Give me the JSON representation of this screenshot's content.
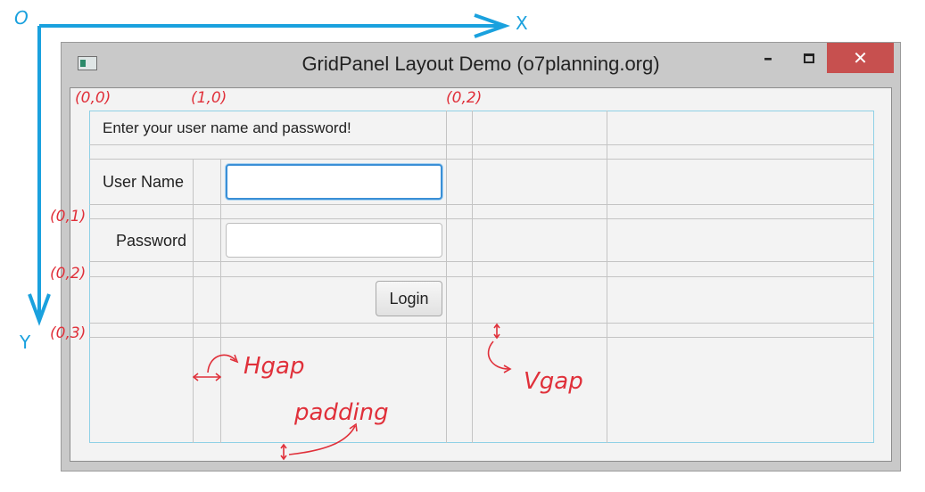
{
  "window": {
    "title": "GridPanel Layout Demo (o7planning.org)",
    "minimize_glyph": "–",
    "close_glyph": "✕"
  },
  "form": {
    "header_text": "Enter your user name and password!",
    "username_label": "User Name",
    "username_value": "",
    "password_label": "Password",
    "password_value": "",
    "login_label": "Login"
  },
  "annotations": {
    "axes": {
      "origin": "O",
      "x": "X",
      "y": "Y"
    },
    "cells": {
      "cell_0_0": "(0,0)",
      "cell_1_0": "(1,0)",
      "cell_0_2_top": "(0,2)",
      "row_0_1": "(0,1)",
      "row_0_2": "(0,2)",
      "row_0_3": "(0,3)"
    },
    "hgap": "Hgap",
    "vgap": "Vgap",
    "padding": "padding"
  },
  "colors": {
    "axis": "#1aa1de",
    "annotation": "#e0303a",
    "grid_border": "#8fd1e6",
    "grid_line": "#c4c4c4",
    "close_button": "#c7504f",
    "focus": "#3a8fd6"
  }
}
